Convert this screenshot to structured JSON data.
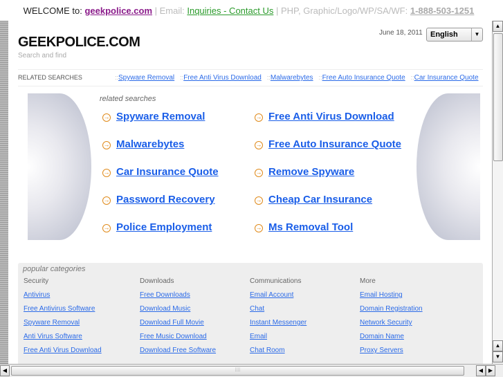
{
  "topbar": {
    "welcome": "WELCOME to: ",
    "site": "geekpolice.com",
    "sep1": " | Email: ",
    "contact": "Inquiries - Contact Us",
    "sep2": " | PHP, Graphic/Logo/WP/SA/WF: ",
    "phone": "1-888-503-1251"
  },
  "header": {
    "logo": "GEEKPOLICE.COM",
    "tagline": "Search and find",
    "date": "June 18, 2011",
    "language": "English"
  },
  "related_bar": {
    "label": "RELATED SEARCHES",
    "separator": "::",
    "links": [
      "Spyware Removal",
      "Free Anti Virus Download",
      "Malwarebytes",
      "Free Auto Insurance Quote",
      "Car Insurance Quote"
    ]
  },
  "related": {
    "title": "related searches",
    "left": [
      "Spyware Removal",
      "Malwarebytes",
      "Car Insurance Quote",
      "Password Recovery",
      "Police Employment"
    ],
    "right": [
      "Free Anti Virus Download",
      "Free Auto Insurance Quote",
      "Remove Spyware",
      "Cheap Car Insurance",
      "Ms Removal Tool"
    ]
  },
  "popular": {
    "title": "popular categories",
    "columns": [
      {
        "heading": "Security",
        "links": [
          "Antivirus",
          "Free Antivirus Software",
          "Spyware Removal",
          "Anti Virus Software",
          "Free Anti Virus Download"
        ]
      },
      {
        "heading": "Downloads",
        "links": [
          "Free Downloads",
          "Download Music",
          "Download Full Movie",
          "Free Music Download",
          "Download Free Software"
        ]
      },
      {
        "heading": "Communications",
        "links": [
          "Email Account",
          "Chat",
          "Instant Messenger",
          "Email",
          "Chat Room"
        ]
      },
      {
        "heading": "More",
        "links": [
          "Email Hosting",
          "Domain Registration",
          "Network Security",
          "Domain Name",
          "Proxy Servers"
        ]
      }
    ]
  }
}
